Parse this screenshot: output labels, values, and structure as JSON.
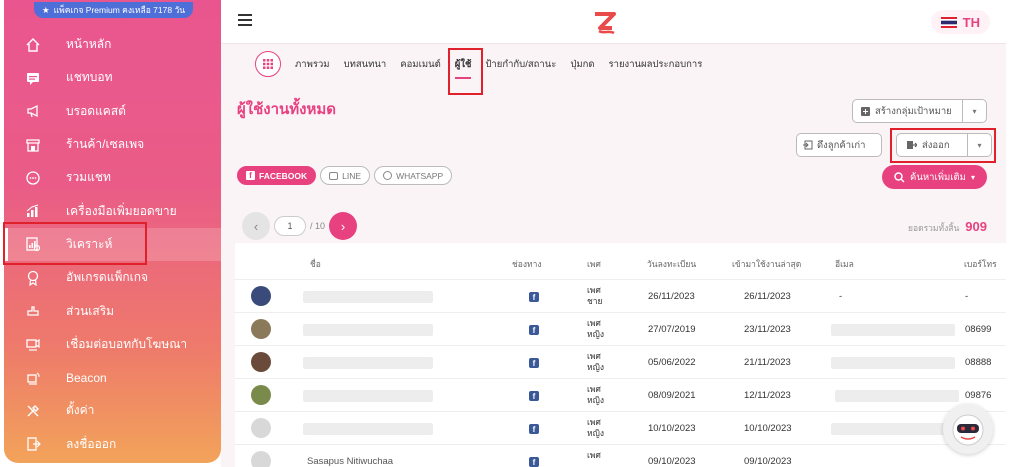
{
  "premium_badge": "แพ็คเกจ Premium คงเหลือ 7178 วัน",
  "sidebar": {
    "items": [
      {
        "label": "หน้าหลัก",
        "icon": "home-icon"
      },
      {
        "label": "แชทบอท",
        "icon": "chat-icon"
      },
      {
        "label": "บรอดแคสต์",
        "icon": "megaphone-icon"
      },
      {
        "label": "ร้านค้า/เซลเพจ",
        "icon": "store-icon"
      },
      {
        "label": "รวมแชท",
        "icon": "chats-icon"
      },
      {
        "label": "เครื่องมือเพิ่มยอดขาย",
        "icon": "chart-icon"
      },
      {
        "label": "วิเคราะห์",
        "icon": "analytics-icon"
      },
      {
        "label": "อัพเกรดแพ็กเกจ",
        "icon": "badge-icon"
      },
      {
        "label": "ส่วนเสริม",
        "icon": "plugin-icon"
      },
      {
        "label": "เชื่อมต่อบอทกับโฆษณา",
        "icon": "ads-icon"
      },
      {
        "label": "Beacon",
        "icon": "beacon-icon"
      },
      {
        "label": "ตั้งค่า",
        "icon": "settings-icon"
      },
      {
        "label": "ลงชื่อออก",
        "icon": "logout-icon"
      }
    ],
    "active_index": 6
  },
  "topbar": {
    "lang": "TH"
  },
  "tabs": [
    "ภาพรวม",
    "บทสนทนา",
    "คอมเมนต์",
    "ผู้ใช้",
    "ป้ายกำกับ/สถานะ",
    "ปุ่มกด",
    "รายงานผลประกอบการ"
  ],
  "active_tab": 3,
  "page_title": "ผู้ใช้งานทั้งหมด",
  "buttons": {
    "create_audience": "สร้างกลุ่มเป้าหมาย",
    "pull_old_customers": "ดึงลูกค้าเก่า",
    "export": "ส่งออก",
    "advanced_search": "ค้นหาเพิ่มเติม"
  },
  "channels": [
    "FACEBOOK",
    "LINE",
    "WHATSAPP"
  ],
  "pager": {
    "current": "1",
    "total": "/ 10"
  },
  "total": {
    "label": "ยอดรวมทั้งสิ้น",
    "value": "909"
  },
  "table": {
    "headers": [
      "ชื่อ",
      "ช่องทาง",
      "เพศ",
      "วันลงทะเบียน",
      "เข้ามาใช้งานล่าสุด",
      "อีเมล",
      "เบอร์โทร"
    ],
    "rows": [
      {
        "gender": "เพศชาย",
        "registered": "26/11/2023",
        "last_seen": "26/11/2023",
        "email": "-",
        "phone": "-",
        "avatar": "#3a4a7a"
      },
      {
        "gender": "เพศหญิง",
        "registered": "27/07/2019",
        "last_seen": "23/11/2023",
        "email": "",
        "phone": "08699",
        "avatar": "#8a7a5a"
      },
      {
        "gender": "เพศหญิง",
        "registered": "05/06/2022",
        "last_seen": "21/11/2023",
        "email": "",
        "phone": "08888",
        "avatar": "#6a4a3a"
      },
      {
        "gender": "เพศหญิง",
        "registered": "08/09/2021",
        "last_seen": "12/11/2023",
        "email": "",
        "phone": "09876",
        "avatar": "#7a8a4a"
      },
      {
        "gender": "เพศหญิง",
        "registered": "10/10/2023",
        "last_seen": "10/10/2023",
        "email": "",
        "phone": "",
        "avatar": "#d8d8d8"
      },
      {
        "gender": "เพศ",
        "registered": "09/10/2023",
        "last_seen": "09/10/2023",
        "email": "",
        "phone": "",
        "avatar": "#d8d8d8",
        "name": "Sasapus Nitiwuchaa"
      }
    ]
  }
}
